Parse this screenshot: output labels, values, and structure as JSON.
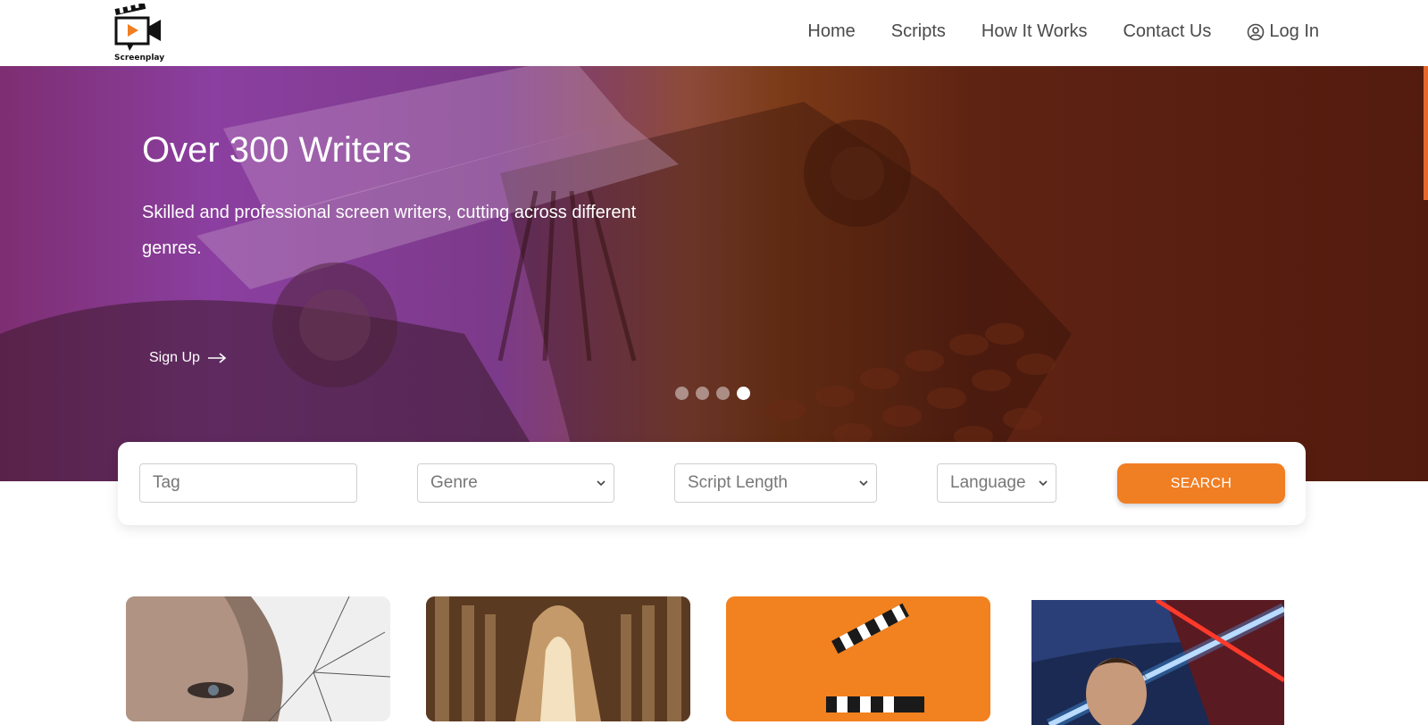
{
  "brand": {
    "name": "Screenplay"
  },
  "nav": {
    "home": "Home",
    "scripts": "Scripts",
    "how_it_works": "How It Works",
    "contact_us": "Contact Us",
    "login": "Log In"
  },
  "hero": {
    "title": "Over 300 Writers",
    "subtitle": "Skilled and professional screen writers, cutting across different genres.",
    "signup": "Sign Up",
    "slides": 4,
    "active_slide": 4
  },
  "search": {
    "tag_placeholder": "Tag",
    "genre": "Genre",
    "script_length": "Script Length",
    "language": "Language",
    "button": "SEARCH"
  },
  "colors": {
    "accent": "#f07e23",
    "hero_purple": "#8b3fa0",
    "hero_brown": "#531b0e"
  },
  "icons": {
    "logo": "film-camera-icon",
    "login": "user-circle-icon",
    "signup_arrow": "arrow-right-icon",
    "select_chevron": "chevron-down-icon"
  }
}
